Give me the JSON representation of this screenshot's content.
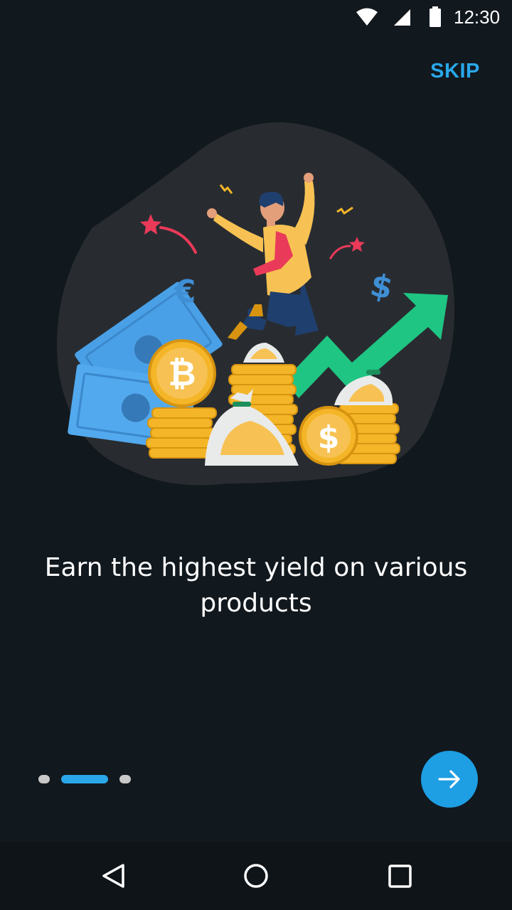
{
  "status_bar": {
    "time": "12:30",
    "icons": [
      "wifi-icon",
      "cell-signal-icon",
      "battery-icon"
    ]
  },
  "header": {
    "skip_label": "SKIP"
  },
  "illustration": {
    "subject": "onboarding-finance-illustration",
    "elements": [
      "bitcoin-coin",
      "dollar-coin",
      "coin-stacks",
      "money-bags",
      "banknotes",
      "green-arrow-up",
      "euro-symbol",
      "dollar-symbol",
      "celebrating-man",
      "stars"
    ]
  },
  "onboarding": {
    "title": "Earn the highest yield on various products",
    "page_count": 3,
    "current_page": 2
  },
  "colors": {
    "background": "#11181e",
    "accent": "#29a7e9",
    "next_button": "#1e9ee3",
    "dot_inactive": "#c8c8c8"
  },
  "nav_bar": {
    "buttons": [
      "back-icon",
      "home-icon",
      "recents-icon"
    ]
  }
}
